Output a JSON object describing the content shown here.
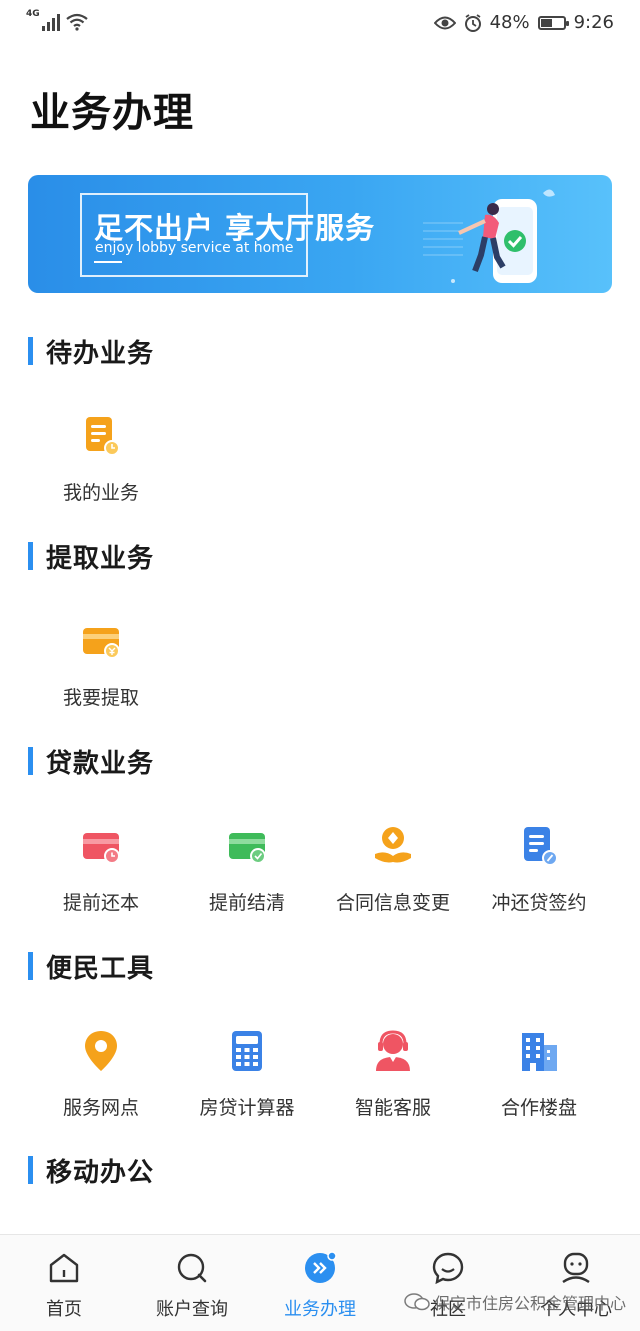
{
  "status_bar": {
    "network": "4G",
    "battery": "48%",
    "battery_level": 0.48,
    "time": "9:26"
  },
  "page_title": "业务办理",
  "banner": {
    "title": "足不出户  享大厅服务",
    "subtitle": "enjoy lobby service at home"
  },
  "sections": {
    "pending": {
      "title": "待办业务",
      "items": [
        {
          "label": "我的业务",
          "icon": "document-clock-icon"
        }
      ]
    },
    "withdraw": {
      "title": "提取业务",
      "items": [
        {
          "label": "我要提取",
          "icon": "card-yuan-icon"
        }
      ]
    },
    "loan": {
      "title": "贷款业务",
      "items": [
        {
          "label": "提前还本",
          "icon": "card-clock-icon"
        },
        {
          "label": "提前结清",
          "icon": "card-check-icon"
        },
        {
          "label": "合同信息变更",
          "icon": "hand-coin-icon"
        },
        {
          "label": "冲还贷签约",
          "icon": "document-sign-icon"
        }
      ]
    },
    "tools": {
      "title": "便民工具",
      "items": [
        {
          "label": "服务网点",
          "icon": "location-pin-icon"
        },
        {
          "label": "房贷计算器",
          "icon": "calculator-icon"
        },
        {
          "label": "智能客服",
          "icon": "headset-agent-icon"
        },
        {
          "label": "合作楼盘",
          "icon": "building-icon"
        }
      ]
    },
    "mobile": {
      "title": "移动办公"
    }
  },
  "bottom_nav": {
    "active": "业务办理",
    "items": [
      {
        "label": "首页",
        "icon": "home-icon"
      },
      {
        "label": "账户查询",
        "icon": "search-icon"
      },
      {
        "label": "业务办理",
        "icon": "forward-icon"
      },
      {
        "label": "社区",
        "icon": "chat-icon"
      },
      {
        "label": "个人中心",
        "icon": "person-icon"
      }
    ]
  },
  "watermark": "保定市住房公积金管理中心",
  "colors": {
    "accent": "#2b8ff0",
    "orange": "#f5a21b",
    "red": "#ef5563",
    "green": "#3fbb5a",
    "blue": "#3b82e6"
  }
}
